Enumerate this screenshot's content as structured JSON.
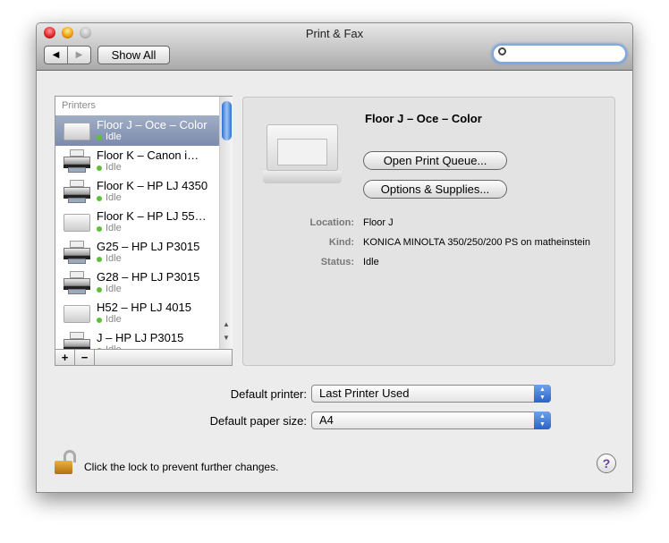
{
  "window": {
    "title": "Print & Fax"
  },
  "toolbar": {
    "back": "◀",
    "forward": "▶",
    "show_all": "Show All",
    "search_placeholder": ""
  },
  "printers": {
    "header": "Printers",
    "items": [
      {
        "name": "Floor J – Oce – Color",
        "status": "Idle",
        "icon": "laser-printer-icon",
        "selected": true
      },
      {
        "name": "Floor K – Canon i…",
        "status": "Idle",
        "icon": "inkjet-printer-icon"
      },
      {
        "name": "Floor K – HP LJ 4350",
        "status": "Idle",
        "icon": "inkjet-printer-icon"
      },
      {
        "name": "Floor K – HP LJ 55…",
        "status": "Idle",
        "icon": "laser-printer-icon"
      },
      {
        "name": "G25 – HP LJ P3015",
        "status": "Idle",
        "icon": "inkjet-printer-icon"
      },
      {
        "name": "G28 – HP LJ P3015",
        "status": "Idle",
        "icon": "inkjet-printer-icon"
      },
      {
        "name": "H52 – HP LJ 4015",
        "status": "Idle",
        "icon": "hp-printer-icon"
      },
      {
        "name": "J – HP LJ P3015",
        "status": "Idle",
        "icon": "inkjet-printer-icon"
      }
    ],
    "add": "+",
    "remove": "−"
  },
  "detail": {
    "name": "Floor J – Oce – Color",
    "open_queue": "Open Print Queue...",
    "options": "Options & Supplies...",
    "location_label": "Location:",
    "location": "Floor J",
    "kind_label": "Kind:",
    "kind": "KONICA MINOLTA 350/250/200 PS on matheinstein",
    "status_label": "Status:",
    "status": "Idle"
  },
  "defaults": {
    "printer_label": "Default printer:",
    "printer": "Last Printer Used",
    "paper_label": "Default paper size:",
    "paper": "A4"
  },
  "lock": {
    "text": "Click the lock to prevent further changes."
  },
  "help": "?",
  "colors": {
    "selection": "#8d9cb8",
    "status_idle": "#5fbf3a",
    "accent": "#2a62c8"
  }
}
